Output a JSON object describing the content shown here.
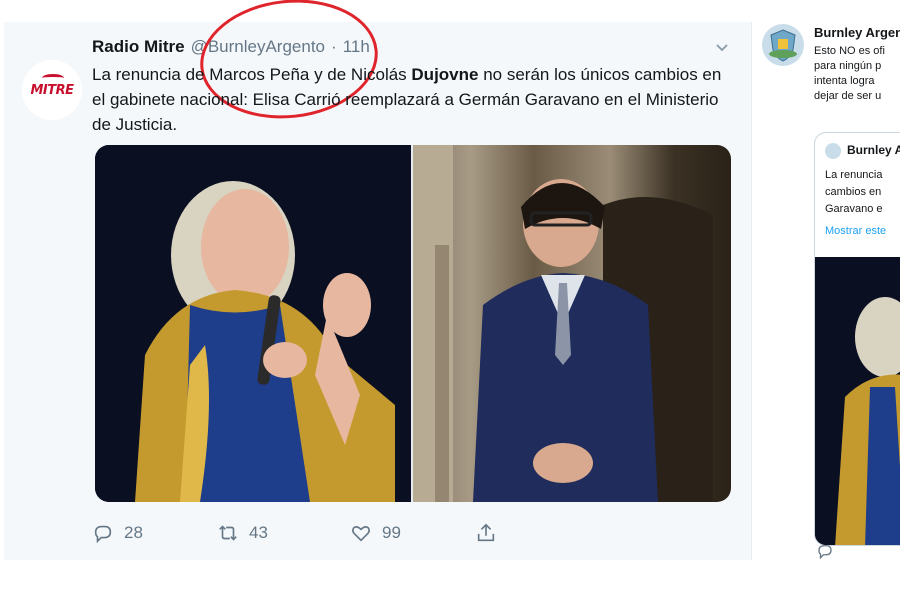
{
  "tweet": {
    "display_name": "Radio Mitre",
    "handle": "@BurnleyArgento",
    "separator": "·",
    "time": "11h",
    "avatar_logo": "MITRE",
    "text_parts": {
      "part1": "La renuncia de Marcos Peña y de Nicolás ",
      "bold": "Dujovne",
      "part2": " no serán los únicos cambios en el gabinete nacional: Elisa Carrió reemplazará a Germán Garavano en el Ministerio de Justicia."
    },
    "media": {
      "left_photo": "woman-speaking-microphone",
      "right_photo": "man-in-suit"
    },
    "actions": {
      "reply_count": "28",
      "retweet_count": "43",
      "like_count": "99"
    },
    "icons": {
      "reply": "reply-icon",
      "retweet": "retweet-icon",
      "like": "heart-icon",
      "share": "share-icon",
      "menu": "chevron-down-icon"
    }
  },
  "side_tweet": {
    "display_name": "Burnley Argento",
    "text_lines": [
      "Esto NO es ofi",
      "para ningún p",
      "intenta logra",
      "dejar de ser u"
    ],
    "quote": {
      "display_name": "Burnley Arg",
      "text_lines": [
        "La renuncia",
        "cambios en",
        "Garavano e"
      ],
      "link": "Mostrar este"
    }
  },
  "colors": {
    "accent": "#1da1f2",
    "annotation_circle": "#e0242c",
    "brand_red": "#c8102e",
    "secondary_text": "#657786"
  }
}
